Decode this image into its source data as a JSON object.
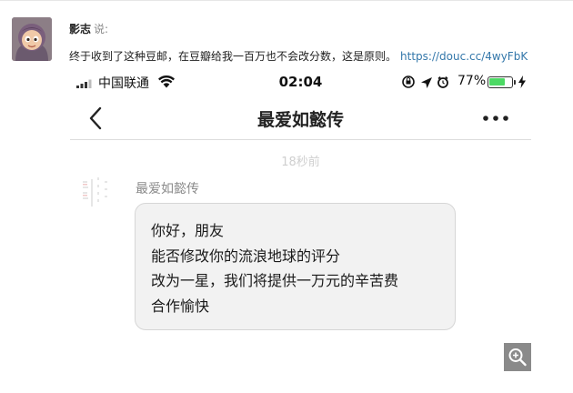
{
  "post": {
    "author": "影志",
    "said": "说:",
    "text": "终于收到了这种豆邮，在豆瓣给我一百万也不会改分数，这是原则。",
    "link": "https://douc.cc/4wyFbK"
  },
  "phone": {
    "status_bar": {
      "carrier": "中国联通",
      "time": "02:04",
      "battery_percent_text": "77%",
      "battery_level": 0.77,
      "battery_color": "#4cd964"
    },
    "nav": {
      "title": "最爱如懿传",
      "back_icon": "chevron-left-icon",
      "more_icon": "more-dots-icon"
    },
    "chat": {
      "timestamp": "18秒前",
      "sender_name": "最爱如懿传",
      "message_lines": [
        "你好，朋友",
        "能否修改你的流浪地球的评分",
        "改为一星，我们将提供一万元的辛苦费",
        "合作愉快"
      ]
    }
  },
  "zoom_icon": "zoom-in-icon",
  "colors": {
    "link": "#3377aa",
    "bubble_bg": "#f2f2f2",
    "timestamp": "#cfcfcf"
  }
}
